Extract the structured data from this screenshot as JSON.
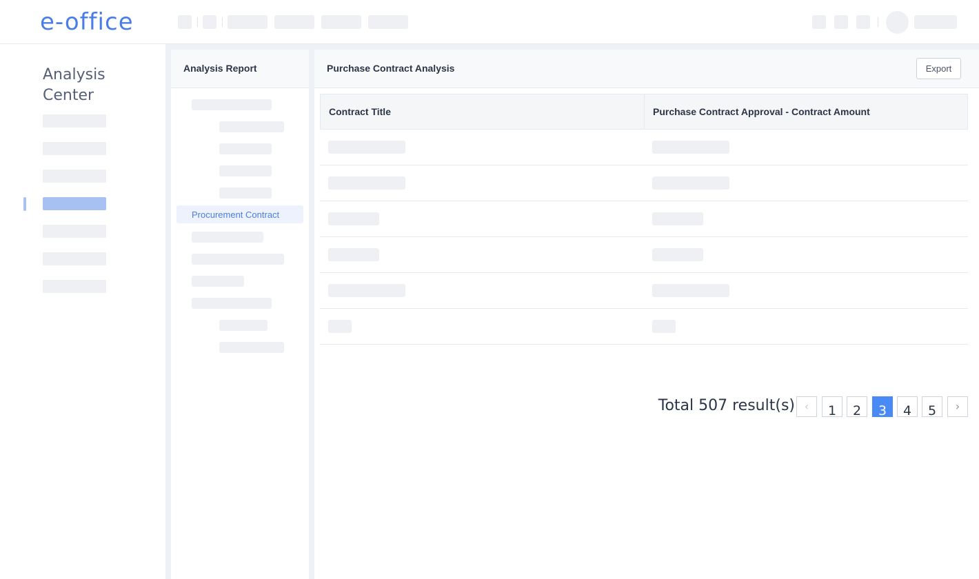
{
  "app": {
    "logo": "e-office"
  },
  "sidebar": {
    "title": "Analysis Center"
  },
  "tree_panel": {
    "title": "Analysis Report",
    "active_item": "Procurement Contract"
  },
  "main_panel": {
    "title": "Purchase Contract Analysis",
    "export_label": "Export",
    "columns": [
      "Contract Title",
      "Purchase Contract Approval - Contract Amount"
    ]
  },
  "pagination": {
    "total_text": "Total 507 result(s)",
    "prev_icon": "‹",
    "next_icon": "›",
    "pages": [
      "1",
      "2",
      "3",
      "4",
      "5"
    ],
    "current_page": "3"
  },
  "colors": {
    "accent": "#4a8af4",
    "brand": "#4a7de8",
    "placeholder": "#eef0f4"
  }
}
